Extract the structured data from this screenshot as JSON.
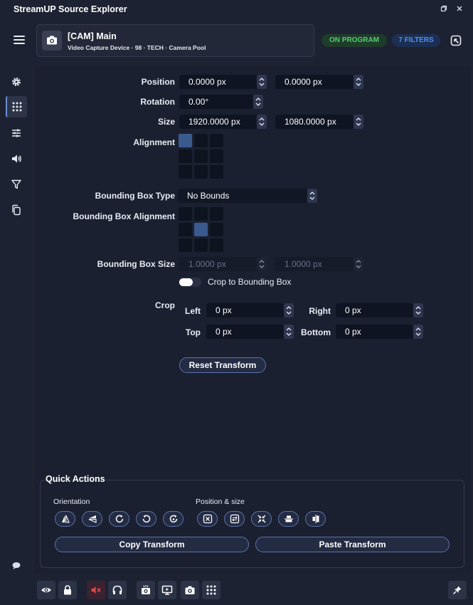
{
  "window": {
    "title": "StreamUP Source Explorer"
  },
  "source": {
    "name": "[CAM] Main",
    "subtitle": "Video Capture Device · 98 · TECH · Camera Pool"
  },
  "badges": {
    "program": "ON PROGRAM",
    "filters": "7 FILTERS"
  },
  "sidebar": {
    "items": [
      "gear-icon",
      "grid-icon",
      "sliders-icon",
      "speaker-icon",
      "filter-icon",
      "copy-icon"
    ],
    "active_index": 1
  },
  "transform": {
    "position_label": "Position",
    "position_x": "0.0000 px",
    "position_y": "0.0000 px",
    "rotation_label": "Rotation",
    "rotation": "0.00°",
    "size_label": "Size",
    "size_w": "1920.0000 px",
    "size_h": "1080.0000 px",
    "alignment_label": "Alignment",
    "alignment_selected": 0,
    "bbox_type_label": "Bounding Box Type",
    "bbox_type": "No Bounds",
    "bbox_alignment_label": "Bounding Box Alignment",
    "bbox_alignment_selected": 4,
    "bbox_size_label": "Bounding Box Size",
    "bbox_w": "1.0000 px",
    "bbox_h": "1.0000 px",
    "crop_to_bbox_label": "Crop to Bounding Box",
    "crop_to_bbox": false,
    "crop_label": "Crop",
    "crop_left_label": "Left",
    "crop_left": "0 px",
    "crop_right_label": "Right",
    "crop_right": "0 px",
    "crop_top_label": "Top",
    "crop_top": "0 px",
    "crop_bottom_label": "Bottom",
    "crop_bottom": "0 px",
    "reset_label": "Reset Transform"
  },
  "quick_actions": {
    "title": "Quick Actions",
    "orientation_label": "Orientation",
    "position_size_label": "Position & size",
    "copy_label": "Copy Transform",
    "paste_label": "Paste Transform"
  },
  "colors": {
    "accent": "#5b72a8",
    "program_green": "#4fd16b",
    "filters_blue": "#4a92ff",
    "muted_red": "#e04848"
  }
}
